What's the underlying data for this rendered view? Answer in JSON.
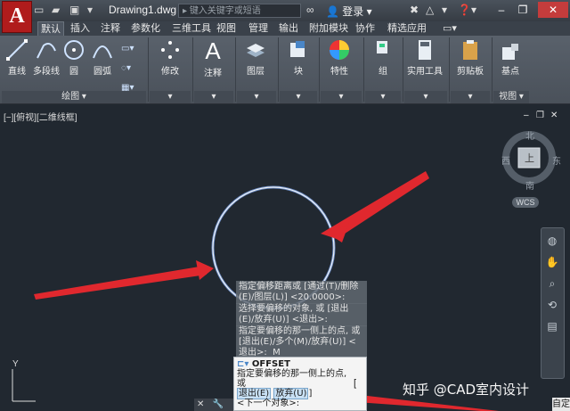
{
  "window": {
    "doc_title": "Drawing1.dwg",
    "search_placeholder": "键入关键字或短语",
    "login": "登录",
    "app_letter": "A"
  },
  "tabs": [
    "默认",
    "插入",
    "注释",
    "参数化",
    "三维工具",
    "视图",
    "管理",
    "输出",
    "附加模块",
    "协作",
    "精选应用"
  ],
  "ribbon": {
    "draw_tools": [
      "直线",
      "多段线",
      "圆",
      "圆弧"
    ],
    "tools": [
      "修改",
      "注释",
      "图层",
      "块",
      "特性",
      "组",
      "实用工具",
      "剪贴板",
      "基点"
    ],
    "group_labels": [
      "绘图",
      "视图"
    ]
  },
  "viewport": {
    "label": "[−][俯视][二维线框]",
    "compass": {
      "north": "北",
      "south": "南",
      "east": "东",
      "west": "西",
      "center": "上"
    },
    "wcs": "WCS",
    "axis_y": "Y"
  },
  "command": {
    "history": [
      "指定偏移距离或 [通过(T)/删除",
      "(E)/图层(L)] <20.0000>:",
      "选择要偏移的对象, 或 [退出",
      "(E)/放弃(U)] <退出>:",
      "指定要偏移的那一侧上的点, 或",
      "[退出(E)/多个(M)/放弃(U)] <",
      "退出>:  M"
    ],
    "command_name": "OFFSET",
    "prompt_line1": "指定要偏移的那一侧上的点,",
    "prompt_line2": "或",
    "option_exit": "退出(E)",
    "option_undo": "放弃(U)",
    "bracket": "]",
    "next_object": "<下一个对象>:",
    "open_bracket": "["
  },
  "status": {
    "custom": "自定"
  },
  "watermark": "知乎 @CAD室内设计",
  "colors": {
    "background": "#212830",
    "ribbon": "#525a63",
    "circle": "#dfe6ee",
    "arrow": "#e0282e"
  }
}
